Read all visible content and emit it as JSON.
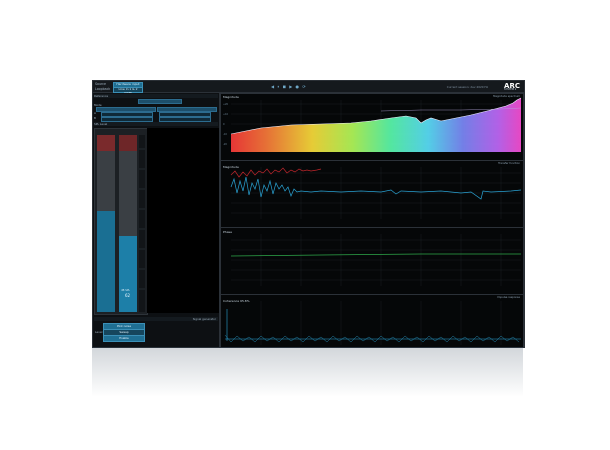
{
  "topbar": {
    "source_label": "Source",
    "loopback_label": "Loopback",
    "active_button": "Hardware input",
    "active_button_sub": "Line In 1 & 2 (USB)",
    "transport": "◀ ⏸ ◼ ▶ ● ⟳",
    "screen_info": "Current session: dev  4020 Hz",
    "logo": "ARC",
    "logo_sub": "SYSTEM 2"
  },
  "leftpanel": {
    "section1_title": "Reference",
    "row_mode": "Mode",
    "row_channel": "BOTH (L+R)",
    "row_a": "A",
    "row_b": "B",
    "meter_title": "SPL Level",
    "meter_value": "62",
    "meter_unit": "dB SPL",
    "generator_title": "Signal generator",
    "btn_pink": "Pink noise",
    "btn_sweep": "Sweep",
    "btn_start": "Enable",
    "level_label": "Level"
  },
  "panels": {
    "magnitude_title": "Magnitude",
    "magnitude_right": "Magnitude spectrum",
    "impulse_title": "Magnitude",
    "impulse_right": "Transfer function",
    "phase_title": "Phase",
    "coherence_title": "Coherence  95.8%",
    "coherence_right": "Impulse response"
  },
  "colors": {
    "accent": "#1f6f93",
    "trace_red": "#c0262c",
    "trace_blue": "#2aa3d4",
    "trace_green": "#2ea84a",
    "meter_red": "#7a2a2c",
    "meter_blue": "#1a6f93"
  }
}
